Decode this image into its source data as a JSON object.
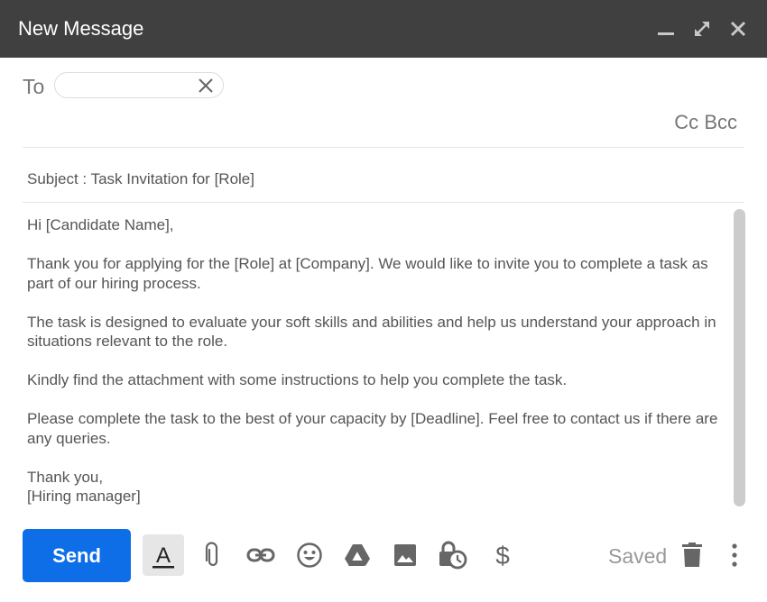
{
  "window": {
    "title": "New Message",
    "controls": [
      {
        "name": "minimize",
        "icon": "minimize-icon"
      },
      {
        "name": "expand",
        "icon": "expand-icon"
      },
      {
        "name": "close",
        "icon": "close-icon"
      }
    ]
  },
  "recipients": {
    "to_label": "To",
    "to_value": "",
    "cc_label": "Cc",
    "bcc_label": "Bcc"
  },
  "subject": {
    "text": "Subject : Task Invitation for [Role]"
  },
  "body": {
    "paragraphs": [
      "Hi [Candidate Name],",
      "Thank you for applying for the [Role] at [Company]. We would like to invite you to complete a task as part of our hiring process.",
      "The task is designed to evaluate your soft skills and abilities and help us understand your approach in situations relevant to the role.",
      "Kindly find the attachment with some instructions to help you complete the task.",
      "Please complete the task to the best of your capacity by [Deadline]. Feel free to contact us if there are any queries.",
      "Thank you,\n[Hiring manager]"
    ],
    "closing_line1": "Thank you,",
    "closing_line2": "[Hiring manager]"
  },
  "toolbar": {
    "send_label": "Send",
    "status": "Saved",
    "tools": [
      "formatting",
      "attach-file",
      "insert-link",
      "emoji",
      "google-drive",
      "insert-photo",
      "confidential-mode",
      "send-money"
    ],
    "accent_color": "#0d6ee8"
  }
}
